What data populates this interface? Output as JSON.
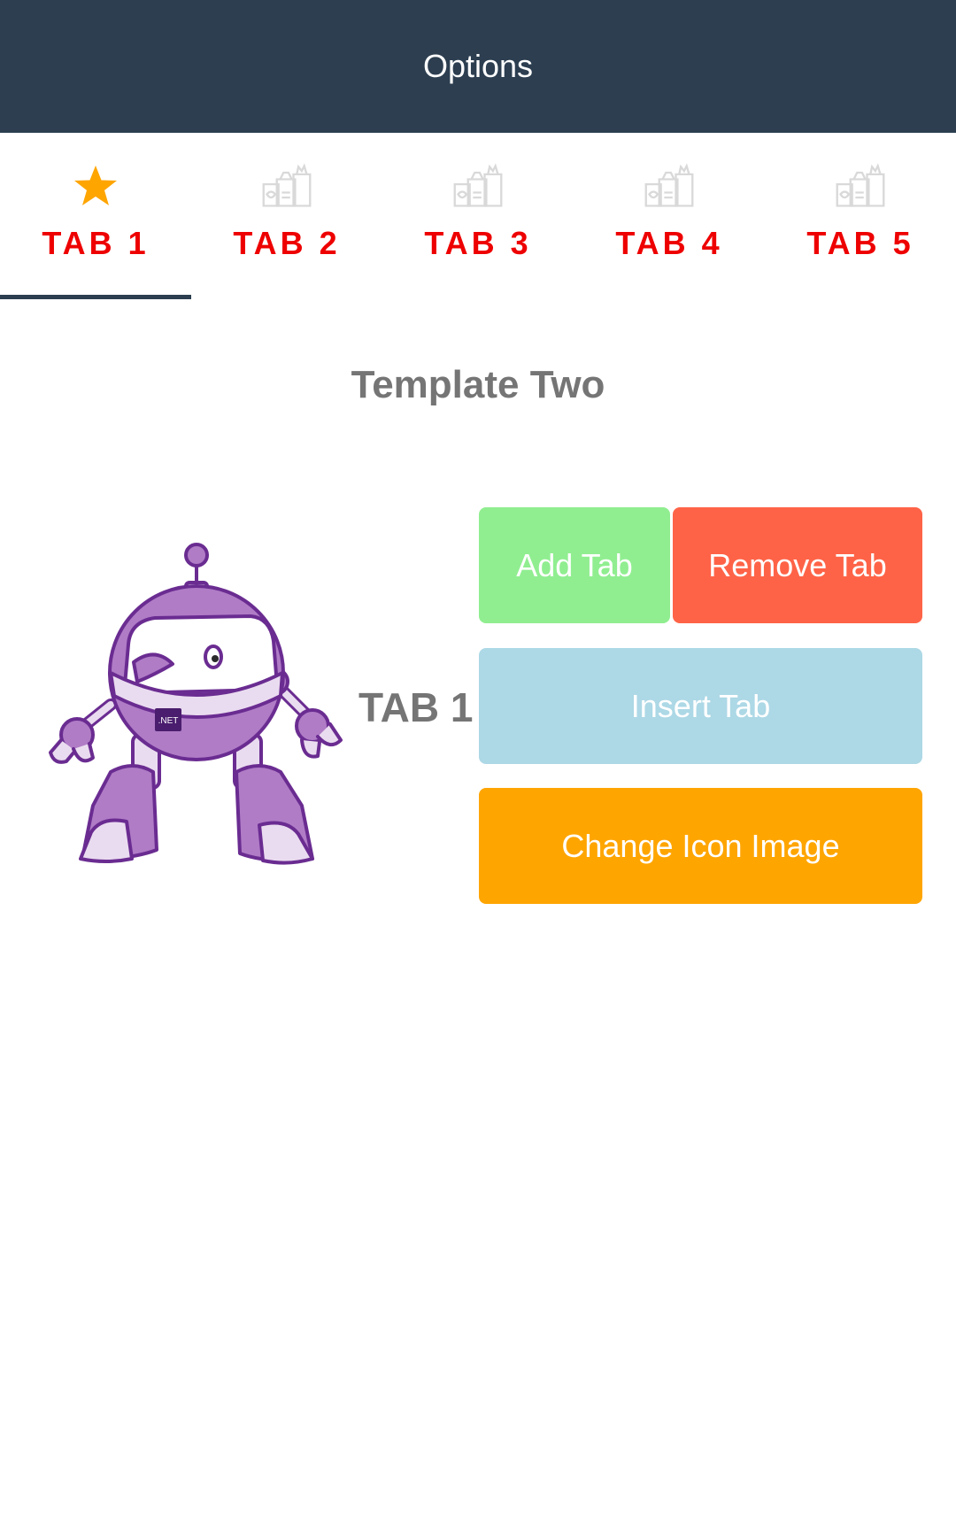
{
  "header": {
    "title": "Options",
    "color": "#2c3e50"
  },
  "tabs": [
    {
      "label": "TAB 1",
      "icon": "star-icon",
      "selected": true
    },
    {
      "label": "TAB 2",
      "icon": "grocery-bag-icon",
      "selected": false
    },
    {
      "label": "TAB 3",
      "icon": "grocery-bag-icon",
      "selected": false
    },
    {
      "label": "TAB 4",
      "icon": "grocery-bag-icon",
      "selected": false
    },
    {
      "label": "TAB 5",
      "icon": "grocery-bag-icon",
      "selected": false
    }
  ],
  "colors": {
    "tab_label": "#ee0000",
    "star": "#ffa500",
    "add": "#90ee90",
    "remove": "#ff6347",
    "insert": "#add8e6",
    "change": "#ffa500"
  },
  "content": {
    "template_title": "Template Two",
    "tab_label": "TAB 1",
    "robot_badge": ".NET",
    "buttons": {
      "add": "Add Tab",
      "remove": "Remove Tab",
      "insert": "Insert Tab",
      "change_icon": "Change Icon Image"
    }
  }
}
